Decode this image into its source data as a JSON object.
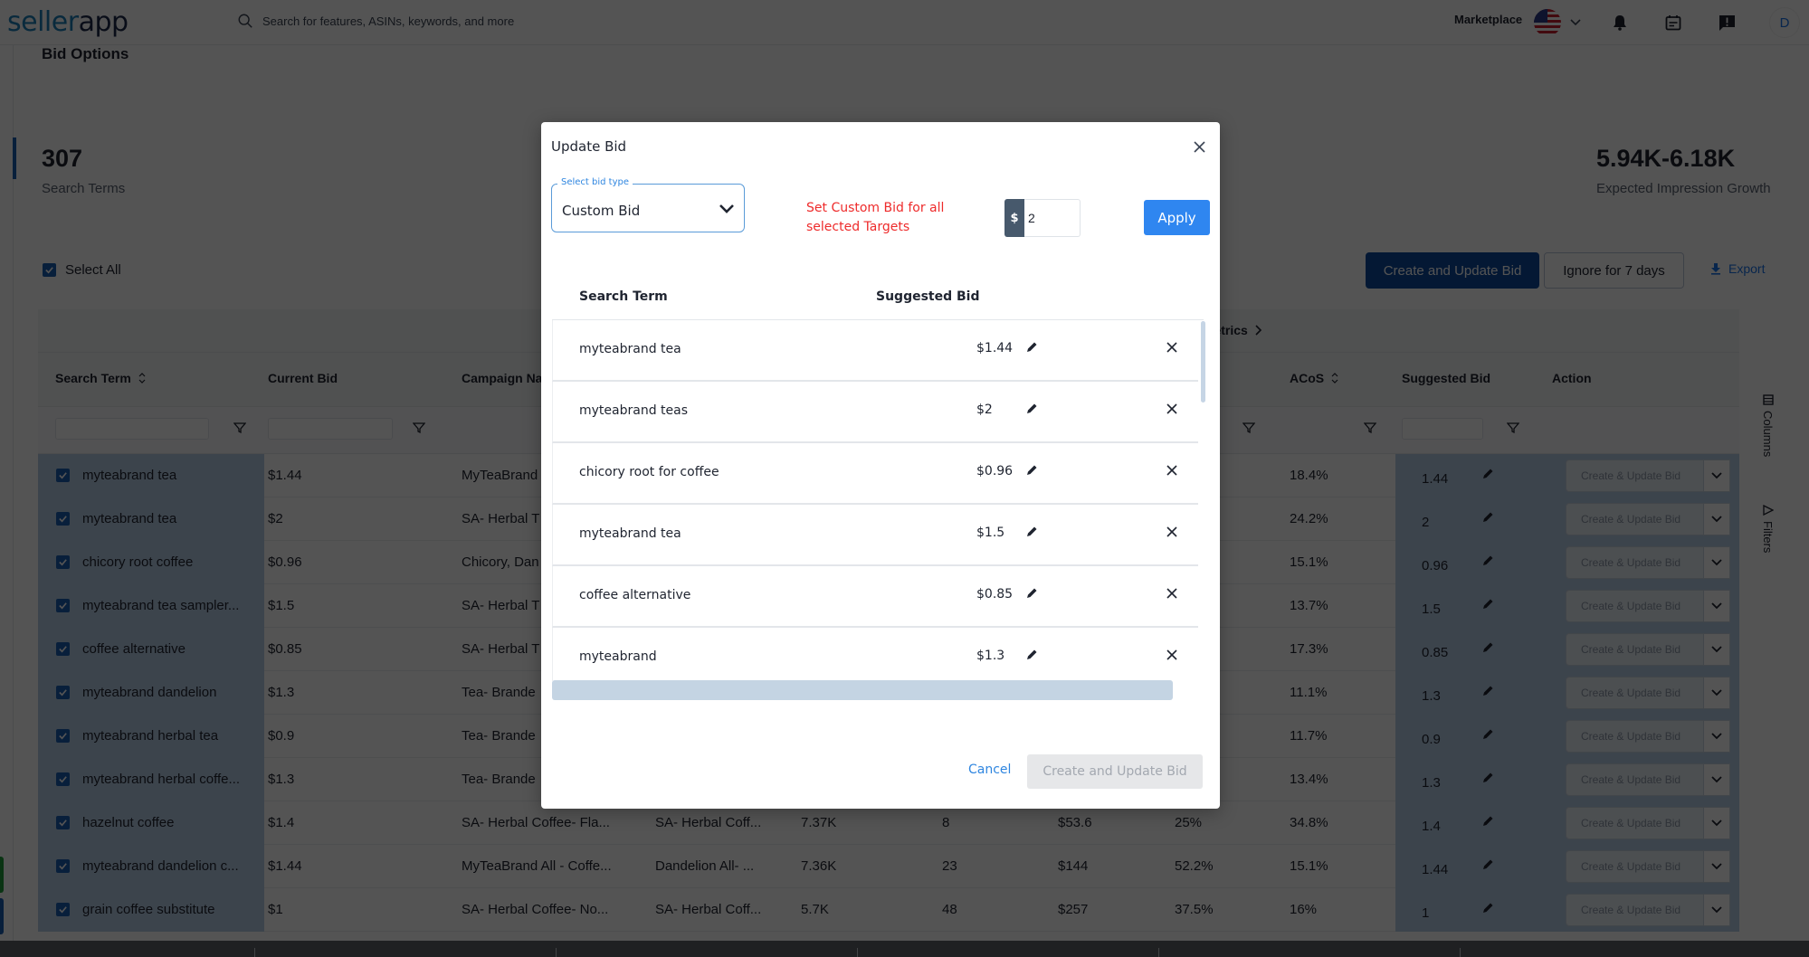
{
  "header": {
    "logo_part1": "seller",
    "logo_part2": "app",
    "search_placeholder": "Search for features, ASINs, keywords, and more",
    "marketplace_label": "Marketplace",
    "avatar_initial": "D"
  },
  "page": {
    "section_title": "Bid Options",
    "stats": [
      {
        "value": "307",
        "label": "Search Terms"
      },
      {
        "value": "5.94K-6.18K",
        "label": "Expected Impression Growth"
      }
    ],
    "select_all_label": "Select All",
    "create_update_bid_label": "Create and Update Bid",
    "ignore_label": "Ignore for 7 days",
    "export_label": "Export"
  },
  "table": {
    "group_label": "l Metrics",
    "columns": {
      "search_term": "Search Term",
      "current_bid": "Current Bid",
      "campaign_name": "Campaign Na",
      "acos": "ACoS",
      "suggested_bid": "Suggested Bid",
      "action": "Action"
    },
    "action_placeholder": "Create & Update Bid",
    "rows": [
      {
        "term": "myteabrand tea",
        "current_bid": "$1.44",
        "campaign": "MyTeaBrand",
        "ad_group": "",
        "impr": "",
        "clicks": "",
        "spend": "",
        "ctr": "",
        "acos": "18.4%",
        "suggested": "1.44"
      },
      {
        "term": "myteabrand tea",
        "current_bid": "$2",
        "campaign": "SA- Herbal T",
        "ad_group": "",
        "impr": "",
        "clicks": "",
        "spend": "",
        "ctr": "",
        "acos": "24.2%",
        "suggested": "2"
      },
      {
        "term": "chicory root coffee",
        "current_bid": "$0.96",
        "campaign": "Chicory, Dan",
        "ad_group": "",
        "impr": "",
        "clicks": "",
        "spend": "",
        "ctr": "",
        "acos": "15.1%",
        "suggested": "0.96"
      },
      {
        "term": "myteabrand tea sampler...",
        "current_bid": "$1.5",
        "campaign": "SA- Herbal T",
        "ad_group": "",
        "impr": "",
        "clicks": "",
        "spend": "",
        "ctr": "",
        "acos": "13.7%",
        "suggested": "1.5"
      },
      {
        "term": "coffee alternative",
        "current_bid": "$0.85",
        "campaign": "SA- Herbal T",
        "ad_group": "",
        "impr": "",
        "clicks": "",
        "spend": "",
        "ctr": "",
        "acos": "17.3%",
        "suggested": "0.85"
      },
      {
        "term": "myteabrand dandelion",
        "current_bid": "$1.3",
        "campaign": "Tea- Brande",
        "ad_group": "",
        "impr": "",
        "clicks": "",
        "spend": "",
        "ctr": "",
        "acos": "11.1%",
        "suggested": "1.3"
      },
      {
        "term": "myteabrand herbal tea",
        "current_bid": "$0.9",
        "campaign": "Tea- Brande",
        "ad_group": "",
        "impr": "",
        "clicks": "",
        "spend": "",
        "ctr": "",
        "acos": "11.7%",
        "suggested": "0.9"
      },
      {
        "term": "myteabrand herbal coffe...",
        "current_bid": "$1.3",
        "campaign": "Tea- Brande",
        "ad_group": "",
        "impr": "",
        "clicks": "",
        "spend": "",
        "ctr": "",
        "acos": "13.4%",
        "suggested": "1.3"
      },
      {
        "term": "hazelnut coffee",
        "current_bid": "$1.4",
        "campaign": "SA- Herbal Coffee- Fla...",
        "ad_group": "SA- Herbal Coff...",
        "impr": "7.37K",
        "clicks": "8",
        "spend": "$53.6",
        "ctr": "25%",
        "acos": "34.8%",
        "suggested": "1.4"
      },
      {
        "term": "myteabrand dandelion c...",
        "current_bid": "$1.44",
        "campaign": "MyTeaBrand All - Coffe...",
        "ad_group": "Dandelion All- ...",
        "impr": "7.36K",
        "clicks": "23",
        "spend": "$144",
        "ctr": "52.2%",
        "acos": "15.1%",
        "suggested": "1.44"
      },
      {
        "term": "grain coffee substitute",
        "current_bid": "$1",
        "campaign": "SA- Herbal Coffee- No...",
        "ad_group": "SA- Herbal Coff...",
        "impr": "5.7K",
        "clicks": "48",
        "spend": "$257",
        "ctr": "37.5%",
        "acos": "16%",
        "suggested": "1"
      }
    ]
  },
  "side_tools": {
    "columns_label": "Columns",
    "filters_label": "Filters"
  },
  "modal": {
    "title": "Update Bid",
    "select_label": "Select bid type",
    "select_value": "Custom Bid",
    "hint": "Set Custom Bid for all selected Targets",
    "currency_symbol": "$",
    "amount_value": "2",
    "apply_label": "Apply",
    "col_search_term": "Search Term",
    "col_suggested_bid": "Suggested Bid",
    "items": [
      {
        "term": "myteabrand tea",
        "bid": "$1.44"
      },
      {
        "term": "myteabrand teas",
        "bid": "$2"
      },
      {
        "term": "chicory root for coffee",
        "bid": "$0.96"
      },
      {
        "term": "myteabrand tea",
        "bid": "$1.5"
      },
      {
        "term": "coffee alternative",
        "bid": "$0.85"
      },
      {
        "term": "myteabrand",
        "bid": "$1.3"
      }
    ],
    "cancel_label": "Cancel",
    "submit_label": "Create and Update Bid"
  }
}
